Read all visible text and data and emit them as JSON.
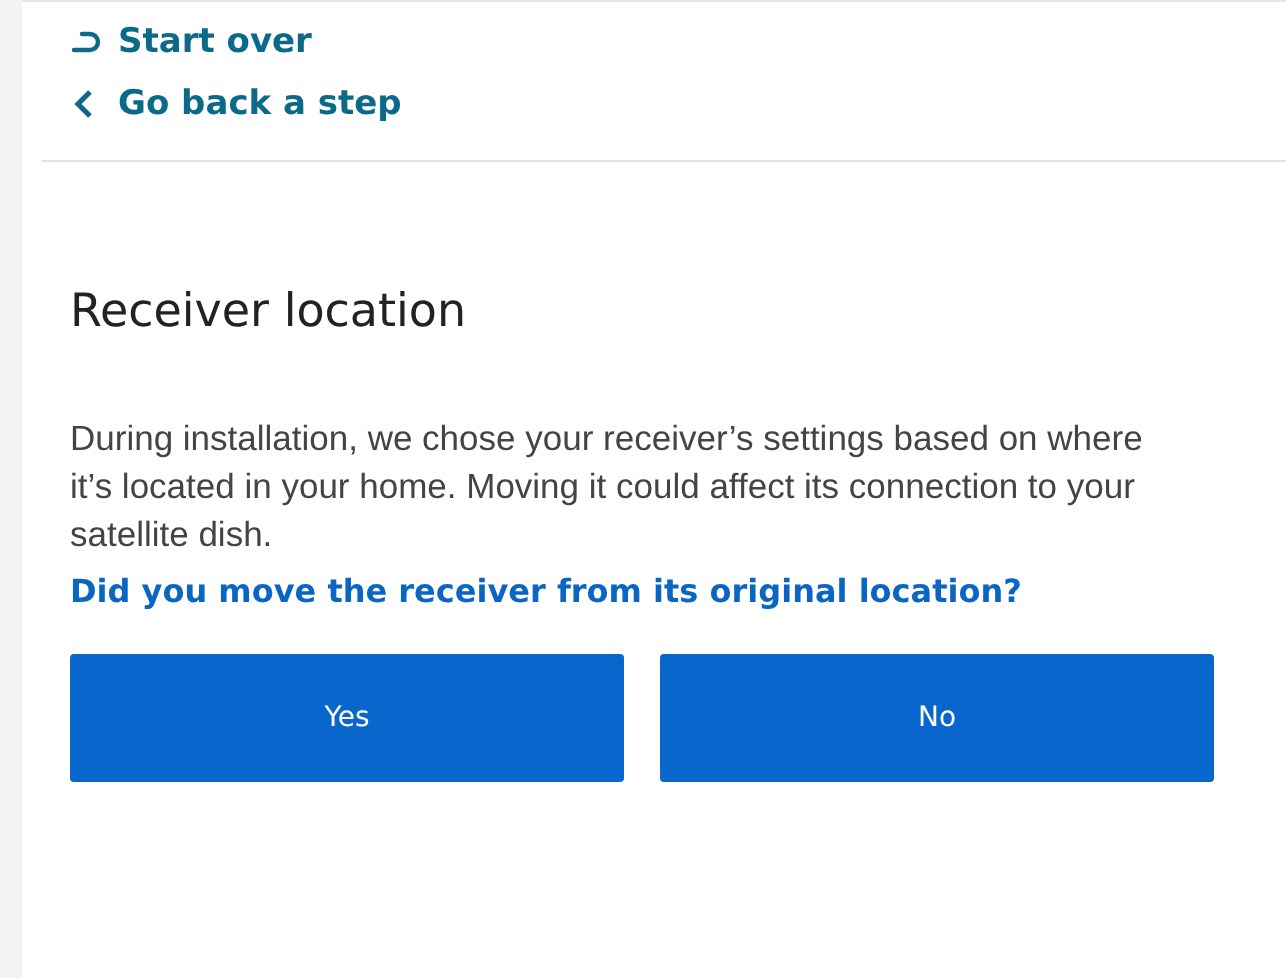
{
  "nav": [
    {
      "kind": "restart",
      "label": "Start over"
    },
    {
      "kind": "back",
      "label": "Go back a step"
    }
  ],
  "title": "Receiver location",
  "description": "During installation, we chose your receiver’s settings based on where it’s located in your home. Moving it could affect its connection to your satellite dish.",
  "question": "Did you move the receiver from its original location?",
  "buttons": [
    "Yes",
    "No"
  ]
}
